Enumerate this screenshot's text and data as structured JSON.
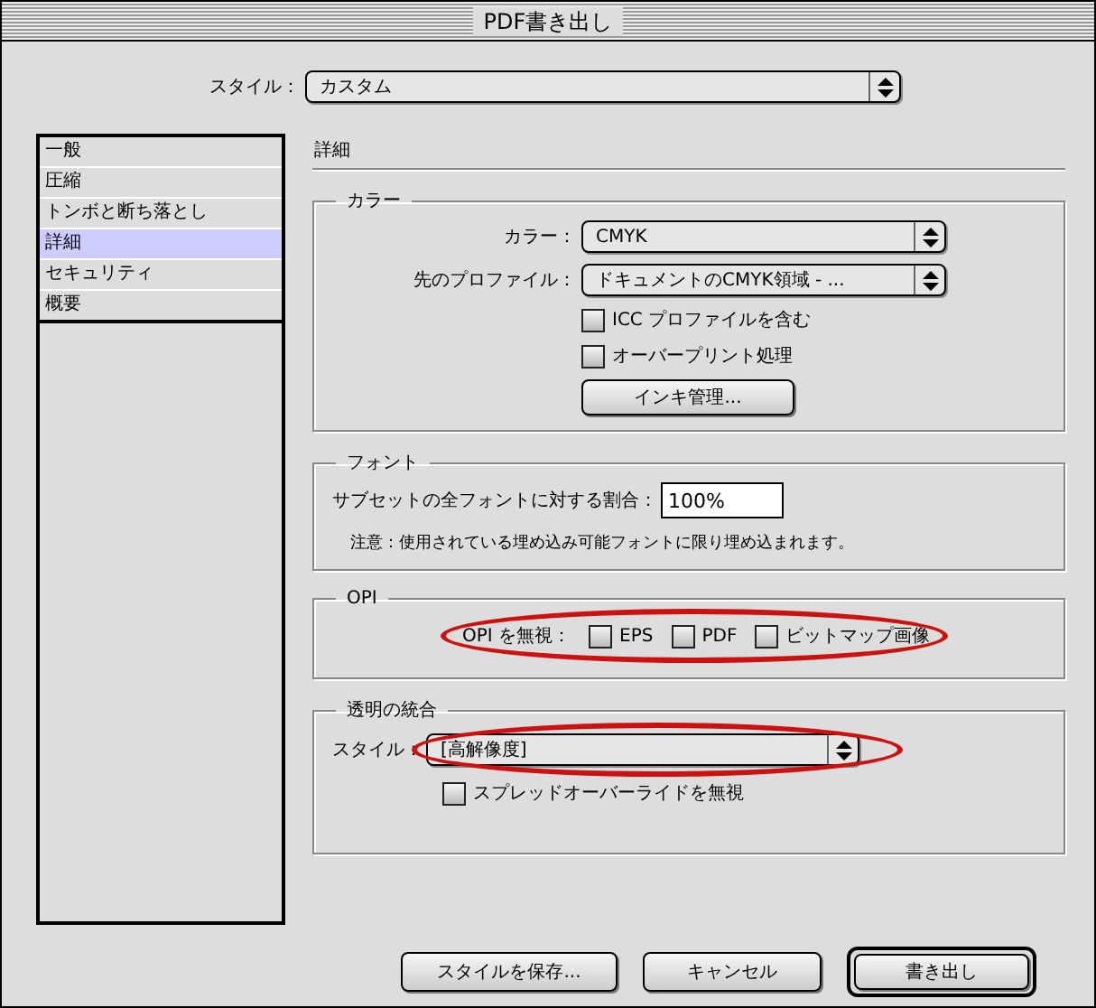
{
  "window": {
    "title": "PDF書き出し"
  },
  "style": {
    "label": "スタイル：",
    "value": "カスタム"
  },
  "sidebar": {
    "items": [
      {
        "label": "一般",
        "selected": false
      },
      {
        "label": "圧縮",
        "selected": false
      },
      {
        "label": "トンボと断ち落とし",
        "selected": false
      },
      {
        "label": "詳細",
        "selected": true
      },
      {
        "label": "セキュリティ",
        "selected": false
      },
      {
        "label": "概要",
        "selected": false
      }
    ]
  },
  "panel": {
    "title": "詳細",
    "color_group": {
      "title": "カラー",
      "color": {
        "label": "カラー：",
        "value": "CMYK"
      },
      "profile": {
        "label": "先のプロファイル：",
        "value": "ドキュメントのCMYK領域 - ..."
      },
      "checkboxes": [
        {
          "label": "ICC プロファイルを含む",
          "checked": false
        },
        {
          "label": "オーバープリント処理",
          "checked": false
        }
      ],
      "button": "インキ管理..."
    },
    "font_group": {
      "title": "フォント",
      "label": "サブセットの全フォントに対する割合：",
      "value": "100%",
      "note": "注意：使用されている埋め込み可能フォントに限り埋め込まれます。"
    },
    "opi_group": {
      "title": "OPI",
      "label": "OPI を無視：",
      "highlighted": true,
      "checkboxes": [
        {
          "label": "EPS",
          "checked": false
        },
        {
          "label": "PDF",
          "checked": false
        },
        {
          "label": "ビットマップ画像",
          "checked": false
        }
      ]
    },
    "transparency_group": {
      "title": "透明の統合",
      "style": {
        "label": "スタイル：",
        "value": "[高解像度]",
        "highlighted": true
      },
      "checkbox": {
        "label": "スプレッドオーバーライドを無視",
        "checked": false
      }
    }
  },
  "buttons": [
    {
      "label": "スタイルを保存...",
      "default": false
    },
    {
      "label": "キャンセル",
      "default": false
    },
    {
      "label": "書き出し",
      "default": true
    }
  ]
}
